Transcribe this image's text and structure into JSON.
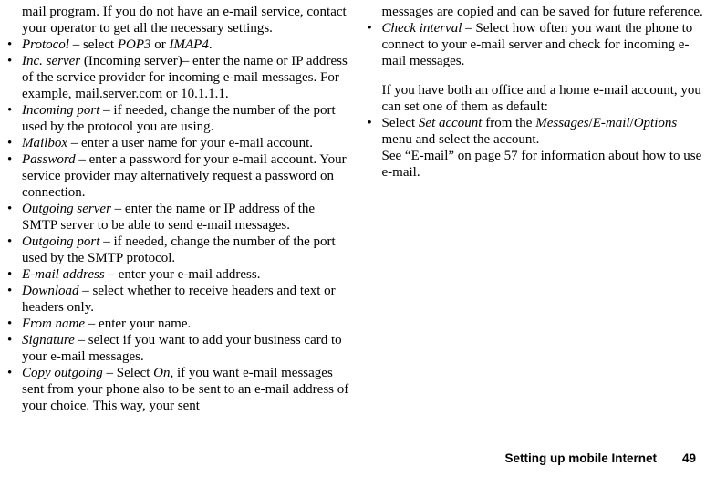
{
  "left": {
    "intro": "mail program. If you do not have an e-mail service, contact your operator to get all the necessary settings.",
    "items": [
      {
        "term": "Protocol",
        "text": " – select ",
        "after1": "POP3",
        "mid": " or ",
        "after2": "IMAP4",
        "tail": "."
      },
      {
        "term": "Inc. server",
        "text": " (Incoming server)– enter the name or IP address of the service provider for incoming e-mail messages. For example, mail.server.com or 10.1.1.1."
      },
      {
        "term": "Incoming port",
        "text": " – if needed, change the number of the port used by the protocol you are using."
      },
      {
        "term": "Mailbox",
        "text": " – enter a user name for your e-mail account."
      },
      {
        "term": "Password",
        "text": " – enter a password for your e-mail account. Your service provider may alternatively request a password on connection."
      },
      {
        "term": "Outgoing server",
        "text": " – enter the name or IP address of the SMTP server to be able to send e-mail messages."
      },
      {
        "term": "Outgoing port",
        "text": " – if needed, change the number of the port used by the SMTP protocol."
      },
      {
        "term": "E-mail address",
        "text": " – enter your e-mail address."
      },
      {
        "term": "Download",
        "text": " – select whether to receive headers and text or headers only."
      },
      {
        "term": "From name",
        "text": " – enter your name."
      },
      {
        "term": "Signature",
        "text": " – select if you want to add your business card to your e-mail messages."
      },
      {
        "term": "Copy outgoing",
        "text": " – Select ",
        "after1": "On",
        "tail": ", if you want e-mail messages sent from your phone also to be sent to an e-mail address of your choice. This way, your sent"
      }
    ]
  },
  "right": {
    "cont1": "messages are copied and can be saved for future reference.",
    "item_ci_term": "Check interval",
    "item_ci_text": " – Select how often you want the phone to connect to your e-mail server and check for incoming e-mail messages.",
    "para2": "If you have both an office and a home e-mail account, you can set one of them as default:",
    "sel_pre": "Select ",
    "sel_i1": "Set account",
    "sel_mid": " from the ",
    "sel_i2": "Messages",
    "sel_slash1": "/",
    "sel_i3": "E-mail",
    "sel_slash2": "/",
    "sel_i4": "Options",
    "sel_post": " menu and select the account.",
    "see": "See “E-mail” on page 57 for information about how to use e-mail."
  },
  "footer": {
    "title": "Setting up mobile Internet",
    "page": "49"
  }
}
